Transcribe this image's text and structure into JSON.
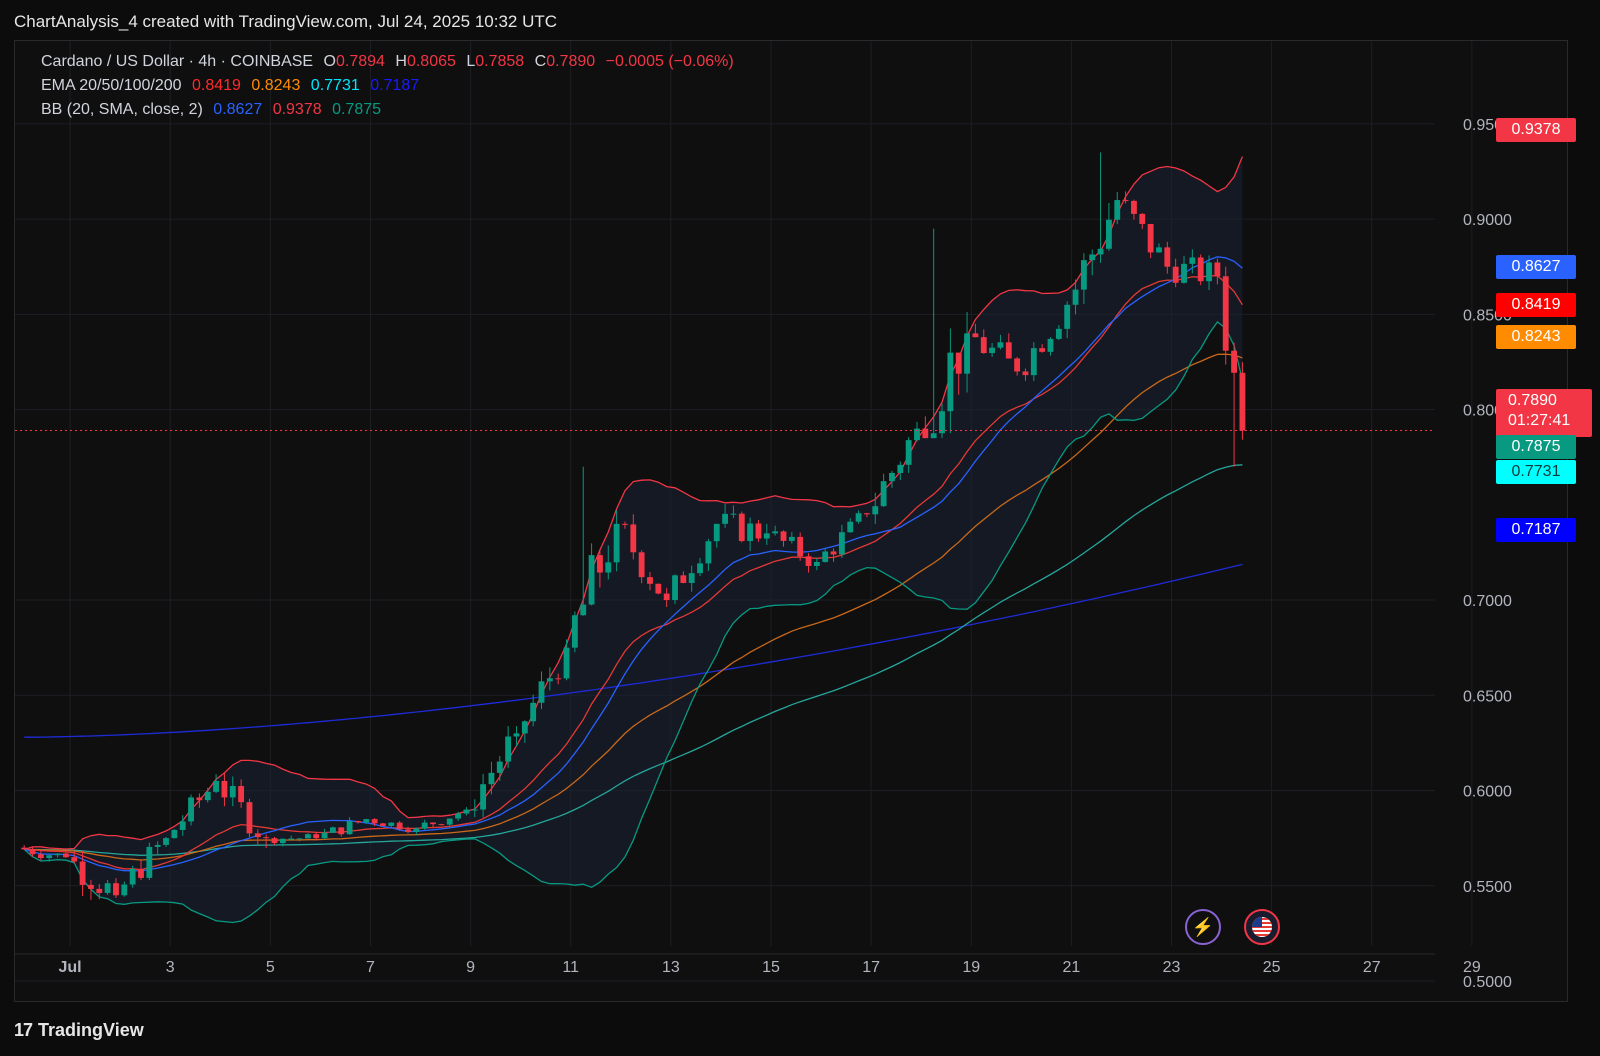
{
  "caption": "ChartAnalysis_4 created with TradingView.com, Jul 24, 2025 10:32 UTC",
  "legend": {
    "symbol_line": {
      "title": "Cardano / US Dollar · 4h · COINBASE",
      "o_label": "O",
      "o_value": "0.7894",
      "h_label": "H",
      "h_value": "0.8065",
      "l_label": "L",
      "l_value": "0.7858",
      "c_label": "C",
      "c_value": "0.7890",
      "change": "−0.0005 (−0.06%)"
    },
    "ema_line": {
      "label": "EMA 20/50/100/200",
      "v20": "0.8419",
      "v50": "0.8243",
      "v100": "0.7731",
      "v200": "0.7187"
    },
    "bb_line": {
      "label": "BB (20, SMA, close, 2)",
      "basis": "0.8627",
      "upper": "0.9378",
      "lower": "0.7875"
    }
  },
  "price_tags": [
    {
      "value": "0.9378",
      "color": "#f23645"
    },
    {
      "value": "0.8627",
      "color": "#2962ff"
    },
    {
      "value": "0.8419",
      "color": "#ff0000"
    },
    {
      "value": "0.8243",
      "color": "#ff8c00"
    },
    {
      "value": "0.7890",
      "color": "#f23645",
      "countdown": "01:27:41"
    },
    {
      "value": "0.7875",
      "color": "#089981"
    },
    {
      "value": "0.7731",
      "color": "#00ffff"
    },
    {
      "value": "0.7187",
      "color": "#0000ff"
    }
  ],
  "event_icons": [
    "lightning-event-icon",
    "us-flag-icon"
  ],
  "footer": {
    "brand": "TradingView"
  },
  "colors": {
    "up": "#089981",
    "down": "#f23645",
    "bb_upper": "#f23645",
    "bb_basis": "#2962ff",
    "bb_lower": "#089981",
    "ema20": "#e53935",
    "ema50": "#c9681a",
    "ema100": "#26a69a",
    "ema200": "#1e2bd8"
  },
  "chart_data": {
    "type": "candlestick",
    "timeframe": "4h",
    "x_axis": {
      "tick_labels": [
        "Jul",
        "3",
        "5",
        "7",
        "9",
        "11",
        "13",
        "15",
        "17",
        "19",
        "21",
        "23",
        "25",
        "27",
        "29"
      ],
      "tick_days": [
        1,
        3,
        5,
        7,
        9,
        11,
        13,
        15,
        17,
        19,
        21,
        23,
        25,
        27,
        29
      ],
      "range_days": [
        -0.1,
        30.9
      ]
    },
    "y_axis": {
      "tick_labels": [
        "0.9500",
        "0.9000",
        "0.8500",
        "0.8000",
        "0.7000",
        "0.6500",
        "0.6000",
        "0.5500",
        "0.5000"
      ],
      "tick_values": [
        0.95,
        0.9,
        0.85,
        0.8,
        0.7,
        0.65,
        0.6,
        0.55,
        0.5
      ],
      "range": [
        0.4895,
        0.9935
      ]
    },
    "grid": true,
    "last_price": 0.789,
    "ohlc_daily_approx": [
      {
        "day": 0,
        "o": 0.57,
        "h": 0.58,
        "l": 0.56,
        "c": 0.565
      },
      {
        "day": 1,
        "o": 0.565,
        "h": 0.59,
        "l": 0.54,
        "c": 0.545
      },
      {
        "day": 2,
        "o": 0.545,
        "h": 0.58,
        "l": 0.54,
        "c": 0.575
      },
      {
        "day": 3,
        "o": 0.575,
        "h": 0.61,
        "l": 0.57,
        "c": 0.605
      },
      {
        "day": 4,
        "o": 0.605,
        "h": 0.61,
        "l": 0.565,
        "c": 0.575
      },
      {
        "day": 5,
        "o": 0.575,
        "h": 0.585,
        "l": 0.57,
        "c": 0.575
      },
      {
        "day": 6,
        "o": 0.575,
        "h": 0.59,
        "l": 0.57,
        "c": 0.585
      },
      {
        "day": 7,
        "o": 0.585,
        "h": 0.59,
        "l": 0.575,
        "c": 0.58
      },
      {
        "day": 8,
        "o": 0.58,
        "h": 0.595,
        "l": 0.575,
        "c": 0.59
      },
      {
        "day": 9,
        "o": 0.59,
        "h": 0.635,
        "l": 0.585,
        "c": 0.63
      },
      {
        "day": 10,
        "o": 0.63,
        "h": 0.68,
        "l": 0.625,
        "c": 0.675
      },
      {
        "day": 11,
        "o": 0.675,
        "h": 0.77,
        "l": 0.67,
        "c": 0.74
      },
      {
        "day": 12,
        "o": 0.74,
        "h": 0.745,
        "l": 0.69,
        "c": 0.7
      },
      {
        "day": 13,
        "o": 0.7,
        "h": 0.74,
        "l": 0.695,
        "c": 0.74
      },
      {
        "day": 14,
        "o": 0.74,
        "h": 0.76,
        "l": 0.715,
        "c": 0.735
      },
      {
        "day": 15,
        "o": 0.735,
        "h": 0.745,
        "l": 0.71,
        "c": 0.72
      },
      {
        "day": 16,
        "o": 0.72,
        "h": 0.75,
        "l": 0.715,
        "c": 0.745
      },
      {
        "day": 17,
        "o": 0.745,
        "h": 0.8,
        "l": 0.74,
        "c": 0.79
      },
      {
        "day": 18,
        "o": 0.79,
        "h": 0.895,
        "l": 0.785,
        "c": 0.84
      },
      {
        "day": 19,
        "o": 0.84,
        "h": 0.845,
        "l": 0.79,
        "c": 0.82
      },
      {
        "day": 20,
        "o": 0.82,
        "h": 0.865,
        "l": 0.815,
        "c": 0.855
      },
      {
        "day": 21,
        "o": 0.855,
        "h": 0.935,
        "l": 0.85,
        "c": 0.91
      },
      {
        "day": 22,
        "o": 0.91,
        "h": 0.915,
        "l": 0.86,
        "c": 0.875
      },
      {
        "day": 23,
        "o": 0.875,
        "h": 0.905,
        "l": 0.86,
        "c": 0.87
      },
      {
        "day": 24,
        "o": 0.87,
        "h": 0.875,
        "l": 0.77,
        "c": 0.789
      }
    ]
  }
}
